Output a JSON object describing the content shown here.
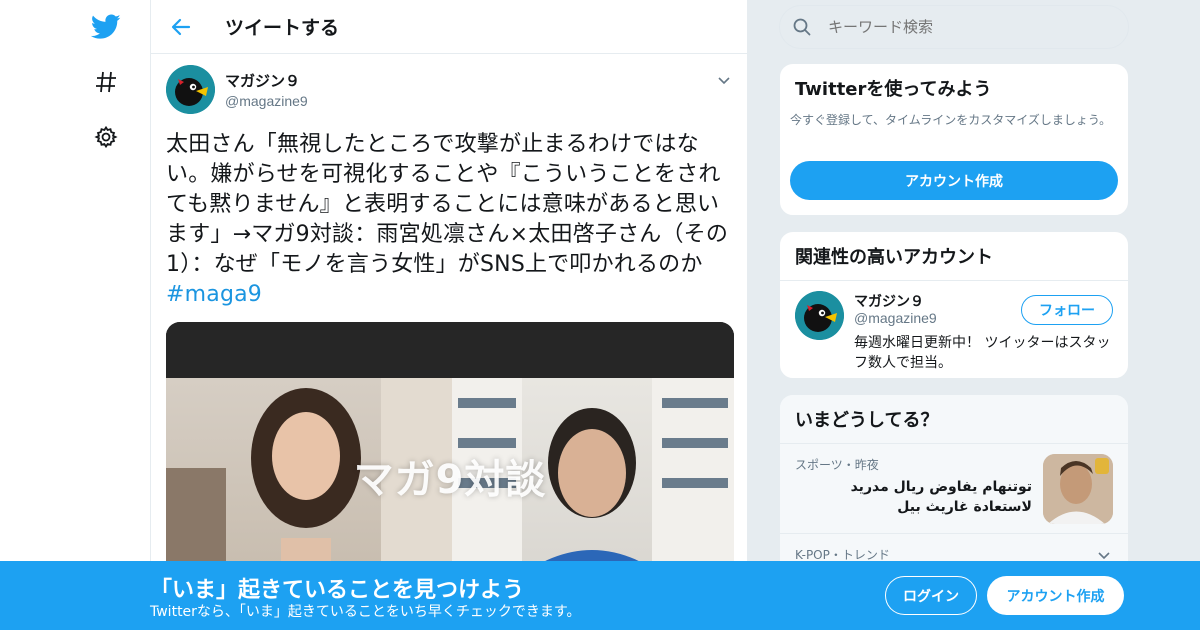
{
  "colors": {
    "accent": "#1da1f2",
    "link": "#1b95e0",
    "secondary_text": "#657786",
    "background": "#e6ecf0"
  },
  "nav": {
    "items": [
      {
        "icon": "twitter-bird-icon"
      },
      {
        "icon": "hashtag-icon"
      },
      {
        "icon": "gear-icon"
      }
    ]
  },
  "header": {
    "back_icon": "arrow-left-icon",
    "title": "ツイートする"
  },
  "tweet": {
    "author_name": "マガジン９",
    "author_handle": "@magazine9",
    "text": "太田さん「無視したところで攻撃が止まるわけではない。嫌がらせを可視化することや『こういうことをされても黙りません』と表明することには意味があると思います」→マガ9対談：雨宮処凛さん×太田啓子さん（その1）：なぜ「モノを言う女性」がSNS上で叩かれるのか ",
    "hashtag": "#maga9",
    "media_caption": "マガ9対談"
  },
  "search": {
    "placeholder": "キーワード検索"
  },
  "signup_card": {
    "title": "Twitterを使ってみよう",
    "description": "今すぐ登録して、タイムラインをカスタマイズしましょう。",
    "button": "アカウント作成"
  },
  "related_card": {
    "title": "関連性の高いアカウント",
    "account": {
      "name": "マガジン９",
      "handle": "@magazine9",
      "bio": "毎週水曜日更新中！ ツイッターはスタッフ数人で担当。",
      "follow_label": "フォロー"
    }
  },
  "trends_card": {
    "title": "いまどうしてる？",
    "items": [
      {
        "meta": "スポーツ・昨夜",
        "text": "توتنهام يفاوض ريال مدريد لاستعادة غاريث بيل"
      },
      {
        "meta": "K-POP・トレンド"
      }
    ]
  },
  "banner": {
    "title": "「いま」起きていることを見つけよう",
    "subtitle": "Twitterなら、「いま」起きていることをいち早くチェックできます。",
    "login": "ログイン",
    "signup": "アカウント作成"
  }
}
